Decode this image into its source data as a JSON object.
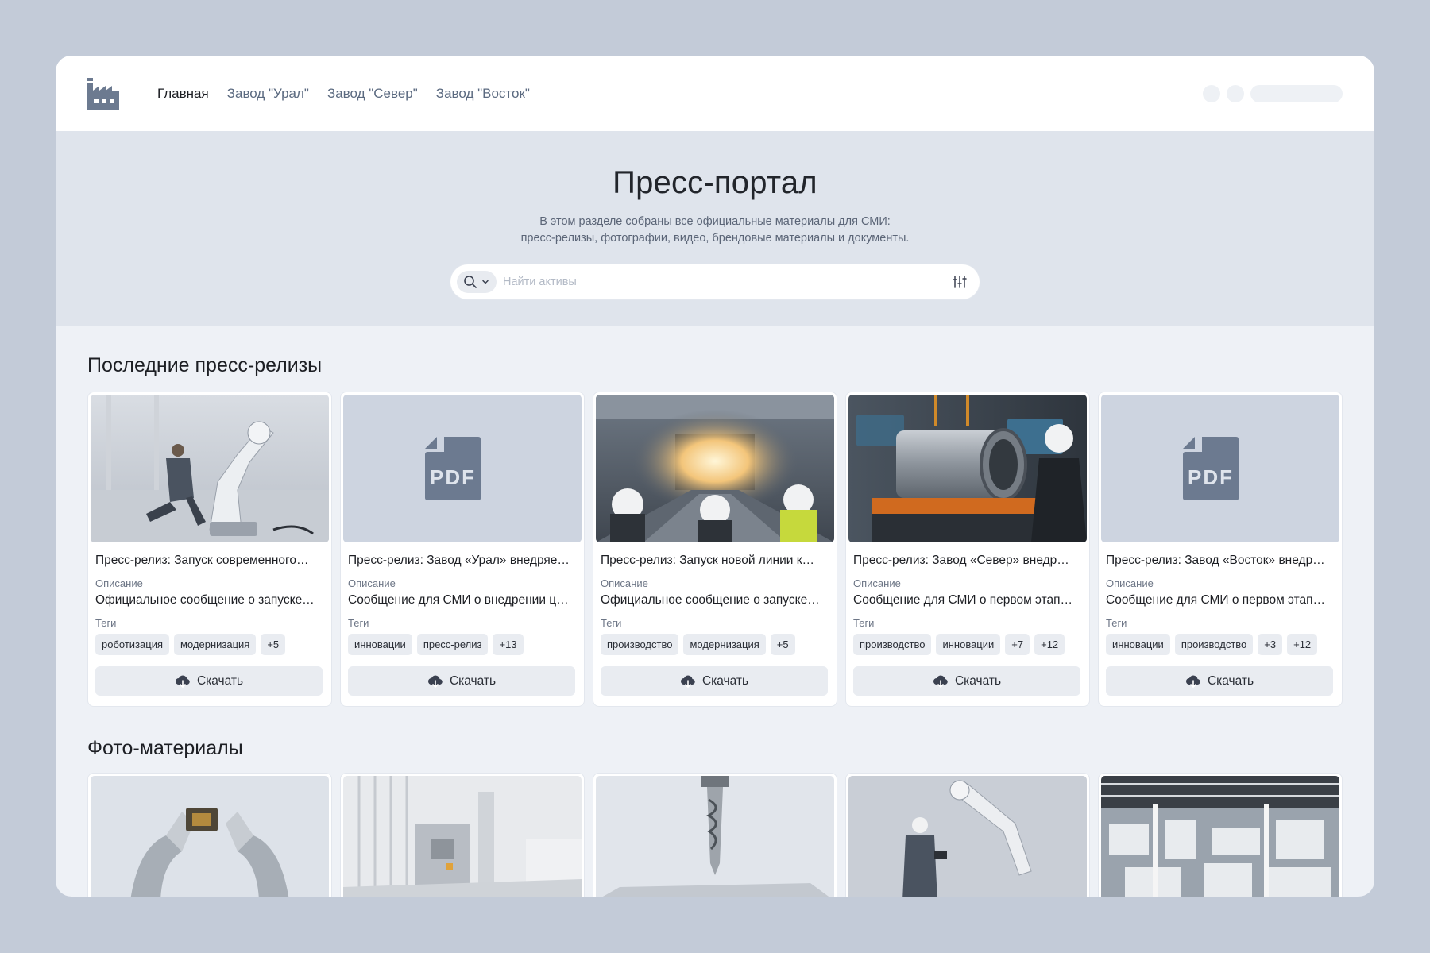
{
  "nav": {
    "items": [
      {
        "label": "Главная",
        "active": true
      },
      {
        "label": "Завод \"Урал\"",
        "active": false
      },
      {
        "label": "Завод \"Север\"",
        "active": false
      },
      {
        "label": "Завод \"Восток\"",
        "active": false
      }
    ]
  },
  "hero": {
    "title": "Пресс-портал",
    "subtitle_line1": "В этом разделе собраны все официальные материалы для СМИ:",
    "subtitle_line2": "пресс-релизы, фотографии, видео, брендовые материалы и документы.",
    "search_placeholder": "Найти активы"
  },
  "press": {
    "title": "Последние пресс-релизы",
    "description_label": "Описание",
    "tags_label": "Теги",
    "download_label": "Скачать",
    "cards": [
      {
        "title": "Пресс-релиз: Запуск современного…",
        "description": "Официальное сообщение о запуске…",
        "tags": [
          "роботизация",
          "модернизация",
          "+5"
        ],
        "thumb": "robot-photo"
      },
      {
        "title": "Пресс-релиз: Завод «Урал» внедряе…",
        "description": "Сообщение для СМИ о внедрении ц…",
        "tags": [
          "инновации",
          "пресс-релиз",
          "+13"
        ],
        "thumb": "pdf"
      },
      {
        "title": "Пресс-релиз: Запуск новой линии к…",
        "description": "Официальное сообщение о запуске…",
        "tags": [
          "производство",
          "модернизация",
          "+5"
        ],
        "thumb": "line-photo"
      },
      {
        "title": "Пресс-релиз: Завод «Север» внедр…",
        "description": "Сообщение для СМИ о первом этап…",
        "tags": [
          "производство",
          "инновации",
          "+7",
          "+12"
        ],
        "thumb": "cylinder-photo"
      },
      {
        "title": "Пресс-релиз: Завод «Восток» внедр…",
        "description": "Сообщение для СМИ о первом этап…",
        "tags": [
          "инновации",
          "производство",
          "+3",
          "+12"
        ],
        "thumb": "pdf"
      }
    ]
  },
  "photos": {
    "title": "Фото-материалы",
    "items": [
      "robot-hands-chip",
      "industrial-hall",
      "drill-bit",
      "engineer-robot-arm",
      "factory-floor"
    ]
  },
  "icons": {
    "logo": "factory-icon",
    "search": "search-icon",
    "mode_chevron": "chevron-down-icon",
    "filter": "sliders-icon",
    "download": "cloud-download-icon",
    "pdf": "pdf-file-icon"
  },
  "colors": {
    "background": "#c3cbd8",
    "hero_bg": "#dfe4ec",
    "page_bg": "#eef1f6",
    "pdf_icon": "#6c7a90",
    "chip_bg": "#e9ecf1"
  }
}
